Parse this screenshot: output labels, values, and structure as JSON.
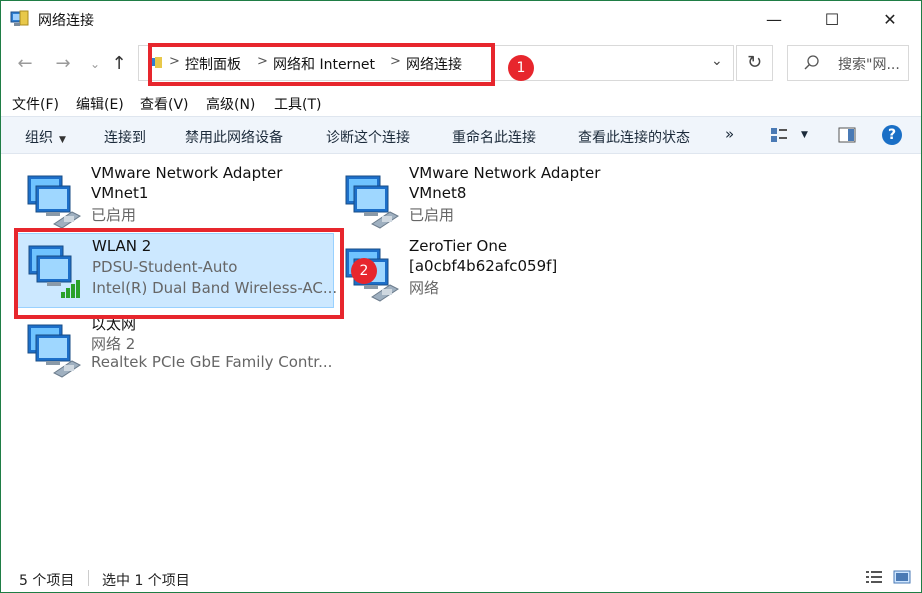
{
  "window": {
    "title": "网络连接",
    "controls": {
      "minimize": "—",
      "maximize": "☐",
      "close": "✕"
    }
  },
  "navigation": {
    "back": "←",
    "forward": "→",
    "recent": "⌄",
    "up": "↑",
    "breadcrumbs": [
      "控制面板",
      "网络和 Internet",
      "网络连接"
    ],
    "separator": ">",
    "dropdown": "⌄",
    "refresh": "↻",
    "search_placeholder": "搜索\"网..."
  },
  "annotations": {
    "badge1": "1",
    "badge2": "2",
    "color": "#e7262d"
  },
  "menu": [
    "文件(F)",
    "编辑(E)",
    "查看(V)",
    "高级(N)",
    "工具(T)"
  ],
  "toolbar": {
    "organize": "组织",
    "items": [
      "连接到",
      "禁用此网络设备",
      "诊断这个连接",
      "重命名此连接",
      "查看此连接的状态"
    ],
    "more": "»",
    "view_caret": "▼"
  },
  "connections": [
    {
      "name": "VMware Network Adapter",
      "line2": "VMnet1",
      "line3": "已启用",
      "icon": "wired-network-icon"
    },
    {
      "name": "VMware Network Adapter",
      "line2": "VMnet8",
      "line3": "已启用",
      "icon": "wired-network-icon"
    },
    {
      "name": "WLAN 2",
      "line2": "PDSU-Student-Auto",
      "line3": "Intel(R) Dual Band Wireless-AC...",
      "icon": "wifi-network-icon",
      "selected": true
    },
    {
      "name": "ZeroTier One",
      "line2": "[a0cbf4b62afc059f]",
      "line3": "网络",
      "icon": "wired-network-icon"
    },
    {
      "name": "以太网",
      "line2": "网络 2",
      "line3": "Realtek PCIe GbE Family Contr...",
      "icon": "wired-network-icon"
    }
  ],
  "status": {
    "count": "5 个项目",
    "selected": "选中 1 个项目"
  }
}
